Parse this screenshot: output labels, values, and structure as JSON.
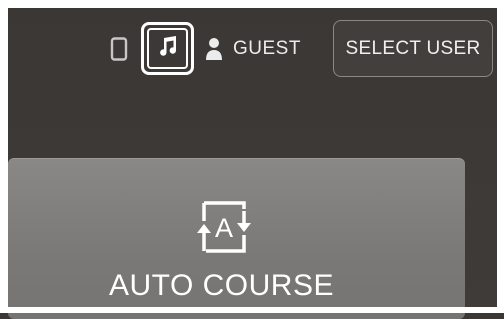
{
  "topbar": {
    "icons": {
      "phone": "phone-icon",
      "music": "music-note-icon",
      "user": "user-icon"
    },
    "user_label": "GUEST",
    "select_user_label": "SELECT USER"
  },
  "tile": {
    "icon": "auto-course-icon",
    "label": "AUTO COURSE",
    "icon_letter": "A"
  },
  "colors": {
    "background": "#3d3937",
    "tile": "#807e7c",
    "text": "#ffffff"
  }
}
